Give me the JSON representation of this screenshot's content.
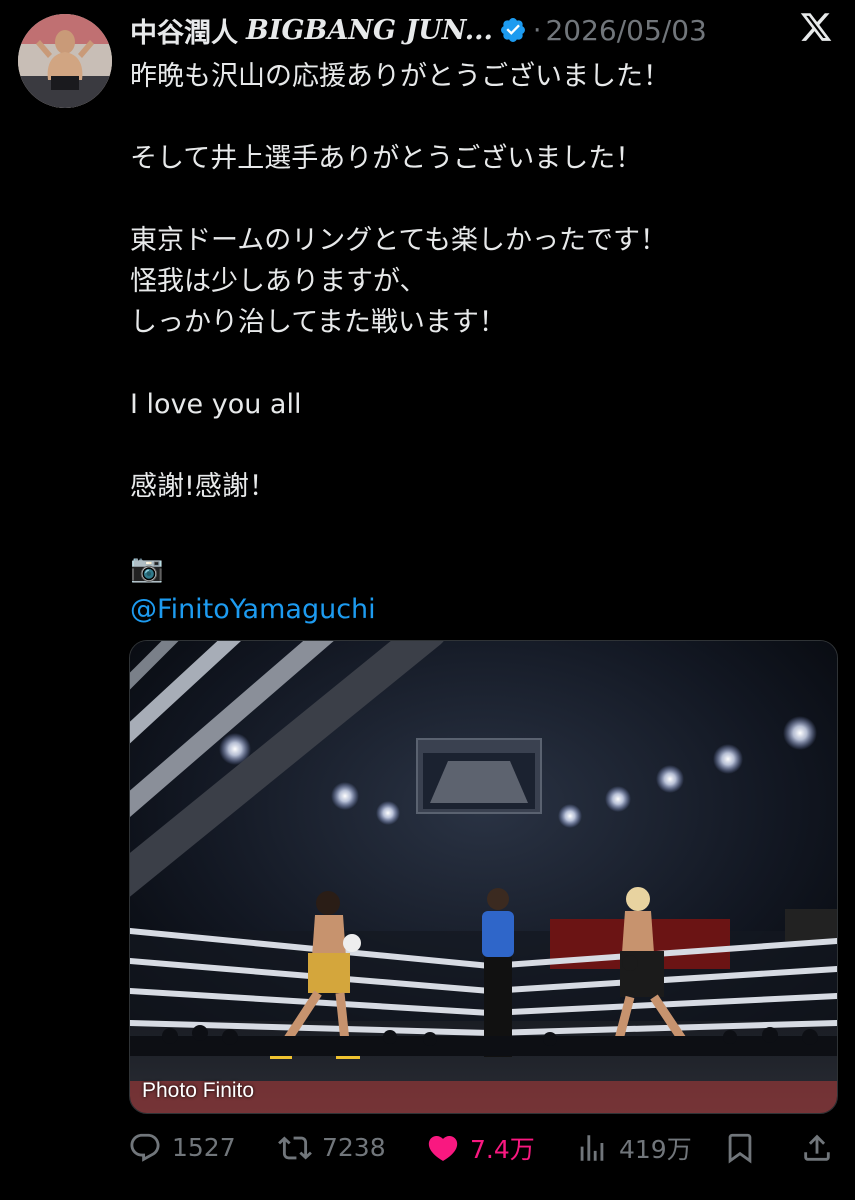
{
  "header": {
    "name": "中谷潤人",
    "name_en": "BIGBANG JUN...",
    "separator": "·",
    "date": "2026/05/03"
  },
  "tweet": {
    "lines": [
      "昨晩も沢山の応援ありがとうございました！",
      "",
      "そして井上選手ありがとうございました！",
      "",
      "東京ドームのリングとても楽しかったです！",
      "怪我は少しありますが、",
      "しっかり治してまた戦います！",
      "",
      "I love you all",
      "",
      "感謝!感謝！",
      "",
      "📷"
    ],
    "mention": "@FinitoYamaguchi"
  },
  "media": {
    "credit": "Photo Finito"
  },
  "actions": {
    "replies": "1527",
    "retweets": "7238",
    "likes": "7.4万",
    "views": "419万"
  },
  "colors": {
    "background": "#000000",
    "text": "#e7e9ea",
    "muted": "#71767b",
    "accent": "#1d9bf0",
    "like": "#f91880"
  }
}
